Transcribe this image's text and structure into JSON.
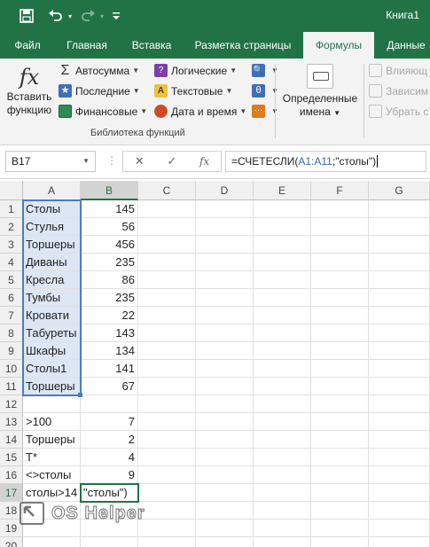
{
  "titlebar": {
    "title": "Книга1"
  },
  "tabs": [
    {
      "label": "Файл"
    },
    {
      "label": "Главная"
    },
    {
      "label": "Вставка"
    },
    {
      "label": "Разметка страницы"
    },
    {
      "label": "Формулы"
    },
    {
      "label": "Данные"
    }
  ],
  "ribbon": {
    "insert_function": {
      "line1": "Вставить",
      "line2": "функцию"
    },
    "autosum": "Автосумма",
    "recent": "Последние",
    "financial": "Финансовые",
    "logical": "Логические",
    "text": "Текстовые",
    "datetime": "Дата и время",
    "defined_names": {
      "line1": "Определенные",
      "line2": "имена"
    },
    "trace_precedents": "Влияющ",
    "trace_dependents": "Зависим",
    "remove_arrows": "Убрать ст",
    "group_label": "Библиотека функций"
  },
  "formula_bar": {
    "name_box": "B17",
    "formula_prefix": "=СЧЕТЕСЛИ(",
    "formula_ref": "A1:A11",
    "formula_suffix": ";\"столы\")"
  },
  "columns": [
    "A",
    "B",
    "C",
    "D",
    "E",
    "F",
    "G"
  ],
  "rows": [
    {
      "n": "1",
      "a": "Столы",
      "b": "145"
    },
    {
      "n": "2",
      "a": "Стулья",
      "b": "56"
    },
    {
      "n": "3",
      "a": "Торшеры",
      "b": "456"
    },
    {
      "n": "4",
      "a": "Диваны",
      "b": "235"
    },
    {
      "n": "5",
      "a": "Кресла",
      "b": "86"
    },
    {
      "n": "6",
      "a": "Тумбы",
      "b": "235"
    },
    {
      "n": "7",
      "a": "Кровати",
      "b": "22"
    },
    {
      "n": "8",
      "a": "Табуреты",
      "b": "143"
    },
    {
      "n": "9",
      "a": "Шкафы",
      "b": "134"
    },
    {
      "n": "10",
      "a": "Столы1",
      "b": "141"
    },
    {
      "n": "11",
      "a": "Торшеры",
      "b": "67"
    },
    {
      "n": "12",
      "a": "",
      "b": ""
    },
    {
      "n": "13",
      "a": ">100",
      "b": "7"
    },
    {
      "n": "14",
      "a": "Торшеры",
      "b": "2"
    },
    {
      "n": "15",
      "a": "Т*",
      "b": "4"
    },
    {
      "n": "16",
      "a": "<>столы",
      "b": "9"
    },
    {
      "n": "17",
      "a": "столы>14",
      "b": "\"столы\")"
    },
    {
      "n": "18",
      "a": "",
      "b": ""
    },
    {
      "n": "19",
      "a": "",
      "b": ""
    },
    {
      "n": "20",
      "a": "",
      "b": ""
    }
  ],
  "watermark": "OS Helper",
  "colors": {
    "excel_green": "#217346",
    "range_blue": "#4a7cc4",
    "range_fill": "#dce6f4"
  }
}
